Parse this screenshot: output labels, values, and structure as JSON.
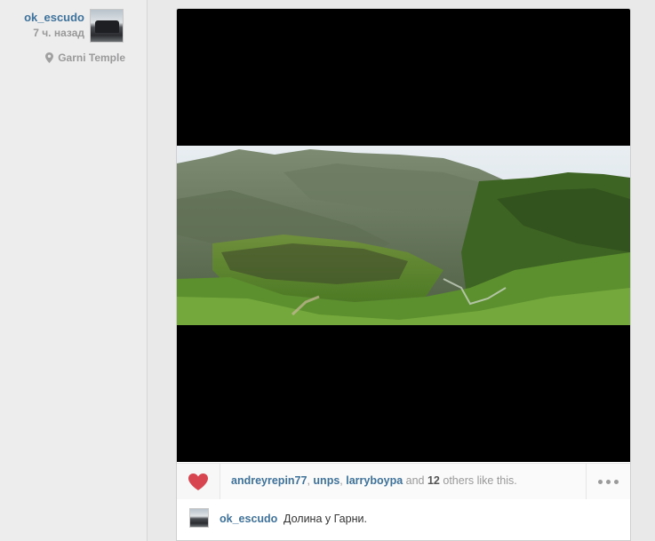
{
  "author": {
    "username": "ok_escudo",
    "time_ago": "7 ч. назад",
    "location": "Garni Temple"
  },
  "likes": {
    "users": [
      "andreyrepin77",
      "unps",
      "larryboypa"
    ],
    "separator": ", ",
    "and_word": "and",
    "others_count": "12",
    "others_suffix": "others like this."
  },
  "comment": {
    "username": "ok_escudo",
    "text": "Долина у Гарни."
  },
  "icons": {
    "heart": "heart-icon",
    "location": "location-pin-icon",
    "more": "more-options-icon"
  },
  "colors": {
    "link": "#3f729b",
    "heart": "#d64550",
    "muted": "#999999"
  }
}
